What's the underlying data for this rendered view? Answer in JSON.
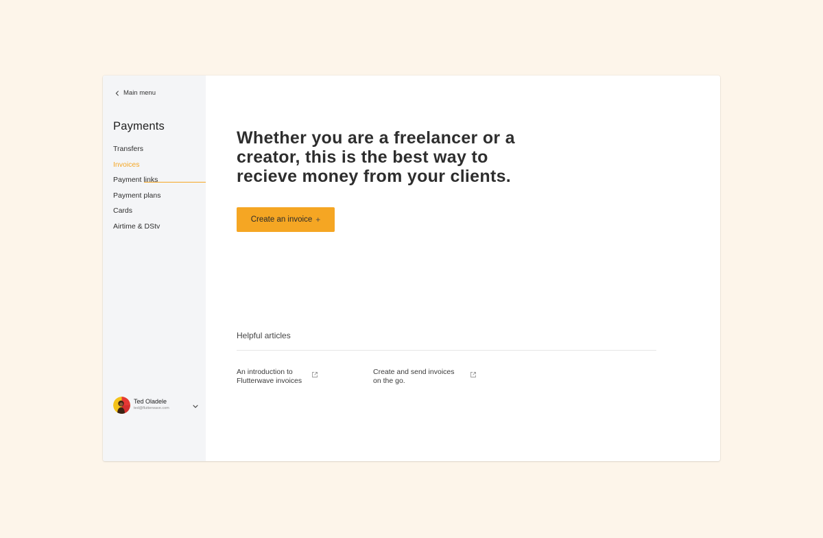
{
  "sidebar": {
    "back_label": "Main menu",
    "section_title": "Payments",
    "items": [
      {
        "label": "Transfers",
        "active": false
      },
      {
        "label": "Invoices",
        "active": true
      },
      {
        "label": "Payment links",
        "active": false
      },
      {
        "label": "Payment plans",
        "active": false
      },
      {
        "label": "Cards",
        "active": false
      },
      {
        "label": "Airtime & DStv",
        "active": false
      }
    ],
    "user": {
      "name": "Ted Oladele",
      "email": "ted@flutterwave.com"
    }
  },
  "main": {
    "headline": "Whether you are a freelancer or a creator, this is the best way to recieve money from your clients.",
    "cta_label": "Create an invoice",
    "cta_icon": "+",
    "articles_title": "Helpful articles",
    "articles": [
      {
        "title": "An introduction to Flutterwave invoices",
        "icon": "external-link-icon"
      },
      {
        "title": "Create and send invoices on the go.",
        "icon": "external-link-icon"
      }
    ]
  },
  "colors": {
    "page_background": "#fdf5ea",
    "sidebar_background": "#f4f5f7",
    "accent": "#f5a623",
    "text": "#2e2e2e"
  }
}
